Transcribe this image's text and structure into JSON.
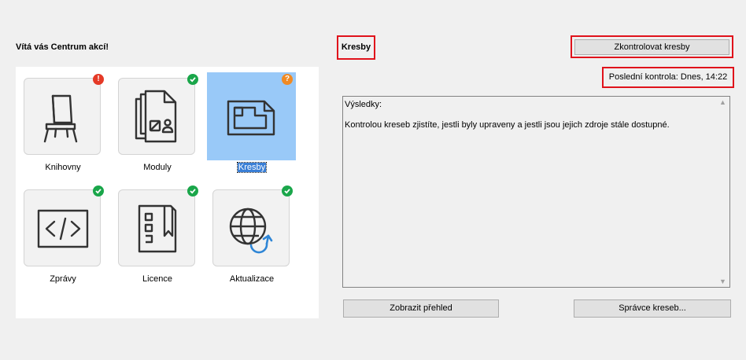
{
  "welcome_text": "Vítá vás Centrum akcí!",
  "tiles": [
    {
      "label": "Knihovny",
      "icon": "chair-icon",
      "status": "error"
    },
    {
      "label": "Moduly",
      "icon": "modules-icon",
      "status": "ok"
    },
    {
      "label": "Kresby",
      "icon": "drawing-icon",
      "status": "warning",
      "selected": true
    },
    {
      "label": "Zprávy",
      "icon": "code-icon",
      "status": "ok"
    },
    {
      "label": "Licence",
      "icon": "license-icon",
      "status": "ok"
    },
    {
      "label": "Aktualizace",
      "icon": "globe-update-icon",
      "status": "ok"
    }
  ],
  "status_symbols": {
    "error": "!",
    "warning": "?"
  },
  "details": {
    "title": "Kresby",
    "check_button": "Zkontrolovat kresby",
    "last_check": "Poslední kontrola: Dnes, 14:22",
    "results_label": "Výsledky:",
    "results_text": "Kontrolou kreseb zjistíte, jestli byly upraveny a jestli jsou jejich zdroje stále dostupné."
  },
  "buttons": {
    "overview": "Zobrazit přehled",
    "manager": "Správce kreseb..."
  },
  "colors": {
    "ok": "#1aa64a",
    "error": "#e53a27",
    "warning": "#f08a24",
    "selection": "#99c9f8",
    "highlight_border": "#e0121b"
  }
}
